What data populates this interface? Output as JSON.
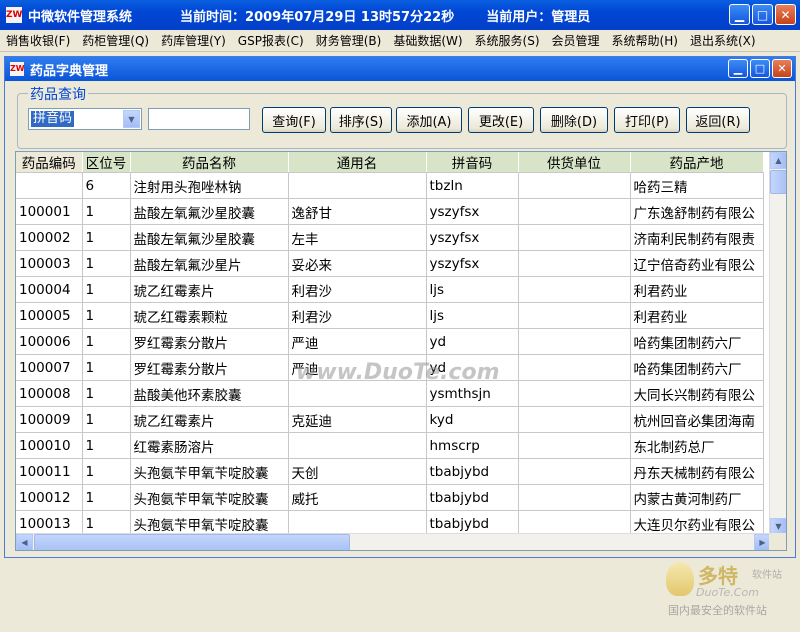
{
  "app": {
    "title": "中微软件管理系统",
    "time_label": "当前时间：",
    "time_value": "2009年07月29日  13时57分22秒",
    "user_label": "当前用户：",
    "user_value": "管理员"
  },
  "menu": [
    {
      "label": "销售收银(F)"
    },
    {
      "label": "药柜管理(Q)"
    },
    {
      "label": "药库管理(Y)"
    },
    {
      "label": "GSP报表(C)"
    },
    {
      "label": "财务管理(B)"
    },
    {
      "label": "基础数据(W)"
    },
    {
      "label": "系统服务(S)"
    },
    {
      "label": "会员管理"
    },
    {
      "label": "系统帮助(H)"
    },
    {
      "label": "退出系统(X)"
    }
  ],
  "child": {
    "title": "药品字典管理"
  },
  "query": {
    "group_label": "药品查询",
    "field_selected": "拼音码",
    "search_value": "",
    "buttons": {
      "query": "查询(F)",
      "sort": "排序(S)",
      "add": "添加(A)",
      "edit": "更改(E)",
      "delete": "删除(D)",
      "print": "打印(P)",
      "back": "返回(R)"
    }
  },
  "table": {
    "headers": [
      "药品编码",
      "区位号",
      "药品名称",
      "通用名",
      "拼音码",
      "供货单位",
      "药品产地"
    ],
    "rows": [
      [
        "",
        "6",
        "注射用头孢唑林钠",
        "",
        "tbzln",
        "",
        "哈药三精"
      ],
      [
        "100001",
        "1",
        "盐酸左氧氟沙星胶囊",
        "逸舒甘",
        "yszyfsx",
        "",
        "广东逸舒制药有限公"
      ],
      [
        "100002",
        "1",
        "盐酸左氧氟沙星胶囊",
        "左丰",
        "yszyfsx",
        "",
        "济南利民制药有限责"
      ],
      [
        "100003",
        "1",
        "盐酸左氧氟沙星片",
        "妥必来",
        "yszyfsx",
        "",
        "辽宁倍奇药业有限公"
      ],
      [
        "100004",
        "1",
        "琥乙红霉素片",
        "利君沙",
        "ljs",
        "",
        "利君药业"
      ],
      [
        "100005",
        "1",
        "琥乙红霉素颗粒",
        "利君沙",
        "ljs",
        "",
        "利君药业"
      ],
      [
        "100006",
        "1",
        "罗红霉素分散片",
        "严迪",
        "yd",
        "",
        "哈药集团制药六厂"
      ],
      [
        "100007",
        "1",
        "罗红霉素分散片",
        "严迪",
        "yd",
        "",
        "哈药集团制药六厂"
      ],
      [
        "100008",
        "1",
        "盐酸美他环素胶囊",
        "",
        "ysmthsjn",
        "",
        "大同长兴制药有限公"
      ],
      [
        "100009",
        "1",
        "琥乙红霉素片",
        "克延迪",
        "kyd",
        "",
        "杭州回音必集团海南"
      ],
      [
        "100010",
        "1",
        "红霉素肠溶片",
        "",
        "hmscrp",
        "",
        "东北制药总厂"
      ],
      [
        "100011",
        "1",
        "头孢氨苄甲氧苄啶胶囊",
        "天创",
        "tbabjybd",
        "",
        "丹东天械制药有限公"
      ],
      [
        "100012",
        "1",
        "头孢氨苄甲氧苄啶胶囊",
        "威托",
        "tbabjybd",
        "",
        "内蒙古黄河制药厂"
      ],
      [
        "100013",
        "1",
        "头孢氨苄甲氧苄啶胶囊",
        "",
        "tbabjybd",
        "",
        "大连贝尔药业有限公"
      ]
    ]
  },
  "watermark": "www.DuoTe.com",
  "logo": {
    "name": "多特",
    "suffix": "软件站",
    "domain": "DuoTe.Com",
    "slogan": "国内最安全的软件站"
  },
  "icons": {
    "app": "app-logo-icon",
    "minimize": "minimize-icon",
    "maximize": "maximize-icon",
    "close": "close-icon"
  }
}
